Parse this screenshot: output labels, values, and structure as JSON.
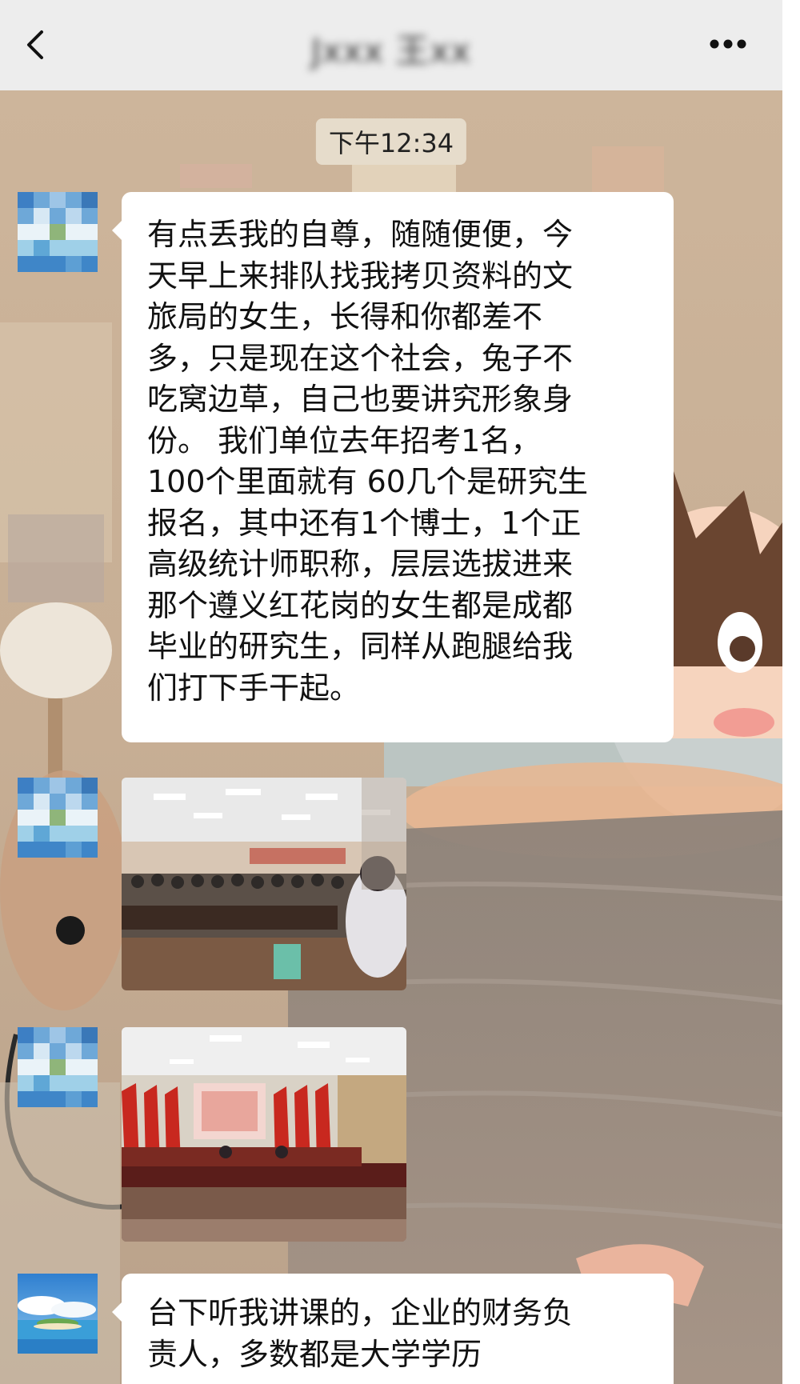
{
  "header": {
    "back_icon": "chevron-left-icon",
    "title_blurred": "Jxxx 王xx",
    "more_icon": "more-dots-icon"
  },
  "timestamp": "下午12:34",
  "messages": [
    {
      "type": "text",
      "lines": [
        "有点丢我的自尊，随随便便，今",
        "天早上来排队找我拷贝资料的文",
        "旅局的女生，长得和你都差不",
        "多，只是现在这个社会，兔子不",
        "吃窝边草，自己也要讲究形象身",
        "份。 我们单位去年招考1名，",
        "100个里面就有 60几个是研究生",
        "报名，其中还有1个博士，1个正",
        "高级统计师职称，层层选拔进来",
        "那个遵义红花岗的女生都是成都",
        "毕业的研究生，同样从跑腿给我",
        "们打下手干起。"
      ]
    },
    {
      "type": "image",
      "description_icon": "photo-classroom-icon"
    },
    {
      "type": "image",
      "description_icon": "photo-meeting-hall-icon"
    },
    {
      "type": "text",
      "lines": [
        "台下听我讲课的，企业的财务负",
        "责人，多数都是大学学历"
      ]
    }
  ],
  "colors": {
    "header_bg": "#ededed",
    "bubble_bg": "#ffffff",
    "timestamp_bg": "#e6dccb"
  }
}
